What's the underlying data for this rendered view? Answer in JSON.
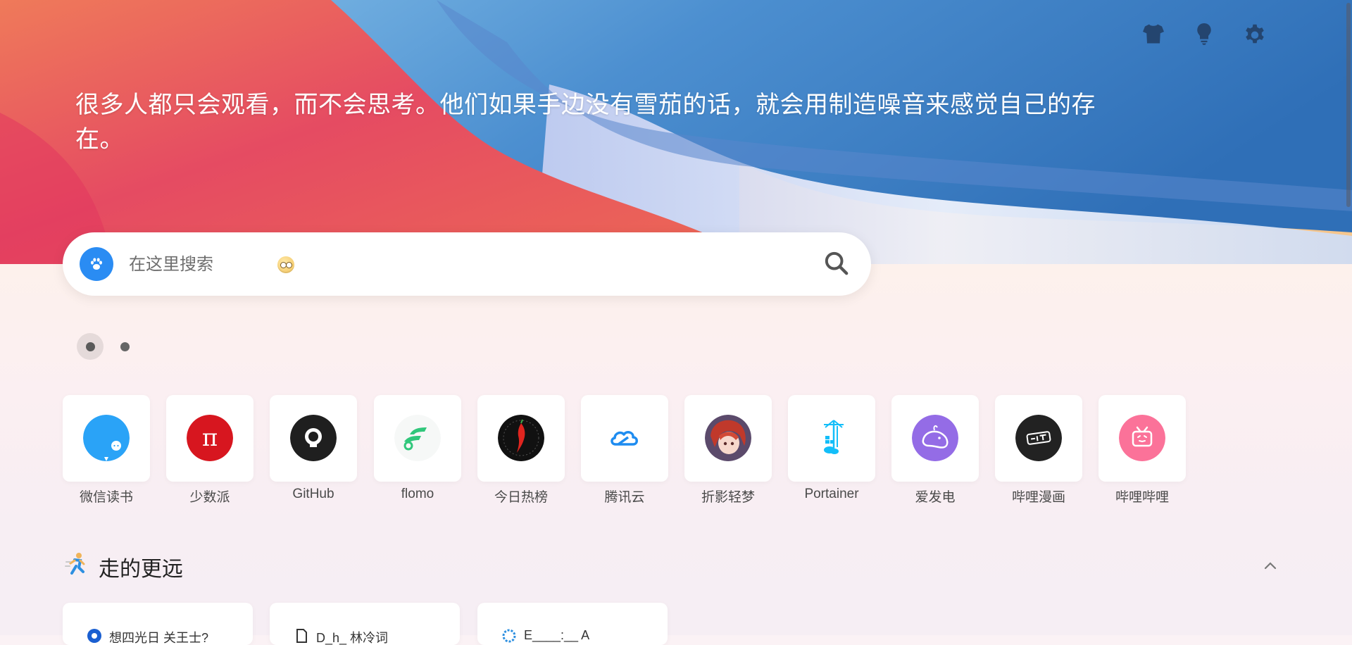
{
  "hero": {
    "quote": "很多人都只会观看，而不会思考。他们如果手边没有雪茄的话，就会用制造噪音来感觉自己的存在。"
  },
  "top_icons": [
    {
      "name": "shirt-icon",
      "label": "theme"
    },
    {
      "name": "bulb-icon",
      "label": "light"
    },
    {
      "name": "gear-icon",
      "label": "settings"
    }
  ],
  "search": {
    "placeholder": "在这里搜索",
    "engine_icon": "paw-icon",
    "engine_color": "#2a8cf3"
  },
  "pager": {
    "current": 1,
    "total": 2
  },
  "apps": [
    {
      "label": "微信读书",
      "color": "#2aa3f7"
    },
    {
      "label": "少数派",
      "color": "#d7161f"
    },
    {
      "label": "GitHub",
      "color": "#1f1f1f"
    },
    {
      "label": "flomo",
      "color": "#30c77b"
    },
    {
      "label": "今日热榜",
      "color": "#111111"
    },
    {
      "label": "腾讯云",
      "color": "#1e8cf0"
    },
    {
      "label": "折影轻梦",
      "color": "#c0392b"
    },
    {
      "label": "Portainer",
      "color": "#13bef9"
    },
    {
      "label": "爱发电",
      "color": "#946ce6"
    },
    {
      "label": "哔哩漫画",
      "color": "#222222"
    },
    {
      "label": "哔哩哔哩",
      "color": "#fb7299"
    }
  ],
  "section": {
    "title": "走的更远",
    "icon": "running-person-icon"
  },
  "cards": [
    {
      "label": "想四光日 关王士?"
    },
    {
      "label": "D_h_ 林冷词"
    },
    {
      "label": "E____:__ A"
    }
  ]
}
